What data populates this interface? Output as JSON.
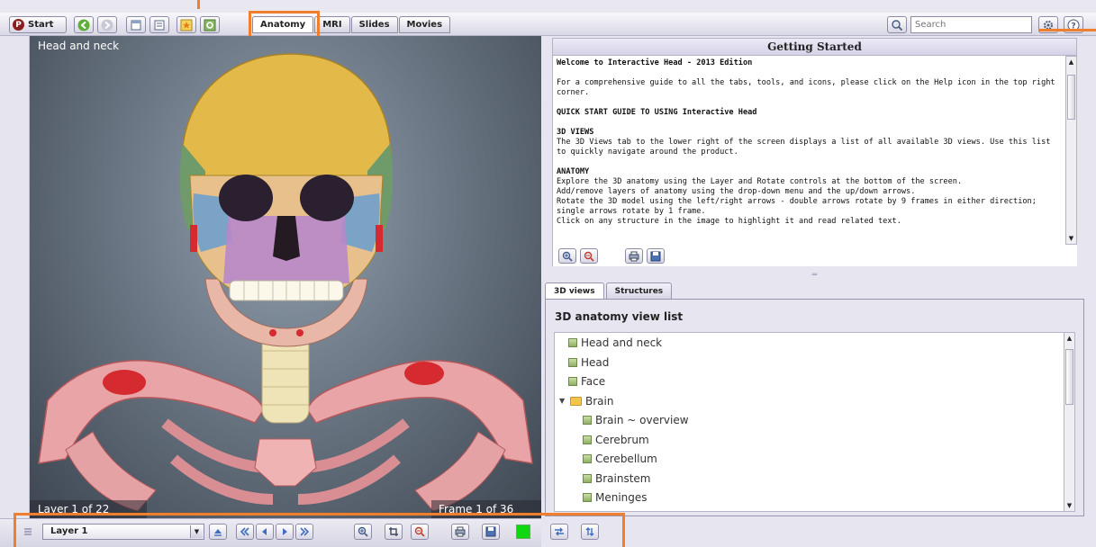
{
  "toolbar": {
    "start_label": "Start",
    "start_logo": "P",
    "icons": [
      "back-arrow-icon",
      "forward-arrow-icon",
      "page-icon",
      "notes-icon",
      "star-icon",
      "settings-gear-icon"
    ],
    "search_placeholder": "Search",
    "right_icons": [
      "settings-icon",
      "help-icon"
    ]
  },
  "tabs": [
    {
      "label": "Anatomy",
      "active": true
    },
    {
      "label": "MRI",
      "active": false
    },
    {
      "label": "Slides",
      "active": false
    },
    {
      "label": "Movies",
      "active": false
    }
  ],
  "viewer": {
    "view_title": "Head and neck",
    "layer_info": "Layer 1 of 22",
    "frame_info": "Frame 1 of 36"
  },
  "getting_started": {
    "title": "Getting Started",
    "lines": [
      {
        "text": "Welcome to Interactive Head - 2013 Edition",
        "bold": true
      },
      {
        "text": "",
        "bold": false
      },
      {
        "text": "For a comprehensive guide to all the tabs, tools, and icons, please click on the Help icon in the top right corner.",
        "bold": false
      },
      {
        "text": "",
        "bold": false
      },
      {
        "text": "QUICK START GUIDE TO USING Interactive Head",
        "bold": true
      },
      {
        "text": "",
        "bold": false
      },
      {
        "text": "3D VIEWS",
        "bold": true
      },
      {
        "text": "The 3D Views tab to the lower right of the screen displays a list of all available 3D views. Use this list to quickly navigate around the product.",
        "bold": false
      },
      {
        "text": "",
        "bold": false
      },
      {
        "text": "ANATOMY",
        "bold": true
      },
      {
        "text": "Explore the 3D anatomy using the Layer and Rotate controls at the bottom of the screen.",
        "bold": false
      },
      {
        "text": "Add/remove layers of anatomy using the drop-down menu and the up/down arrows.",
        "bold": false
      },
      {
        "text": "Rotate the 3D model using the left/right arrows - double arrows rotate by 9 frames in either direction; single arrows rotate by 1 frame.",
        "bold": false
      },
      {
        "text": "Click on any structure in the image to highlight it and read related text.",
        "bold": false
      }
    ],
    "tool_icons": [
      "zoom-in-icon",
      "zoom-out-icon",
      "print-icon",
      "save-icon"
    ]
  },
  "lower_tabs": [
    {
      "label": "3D views",
      "active": true
    },
    {
      "label": "Structures",
      "active": false
    }
  ],
  "views": {
    "title": "3D anatomy view list",
    "items": [
      {
        "label": "Head and neck",
        "level": 0,
        "type": "view"
      },
      {
        "label": "Head",
        "level": 0,
        "type": "view"
      },
      {
        "label": "Face",
        "level": 0,
        "type": "view"
      },
      {
        "label": "Brain",
        "level": 0,
        "type": "folder"
      },
      {
        "label": "Brain ~ overview",
        "level": 1,
        "type": "view"
      },
      {
        "label": "Cerebrum",
        "level": 1,
        "type": "view"
      },
      {
        "label": "Cerebellum",
        "level": 1,
        "type": "view"
      },
      {
        "label": "Brainstem",
        "level": 1,
        "type": "view"
      },
      {
        "label": "Meninges",
        "level": 1,
        "type": "view"
      }
    ]
  },
  "bottom": {
    "layer_value": "Layer 1",
    "color_swatch": "#10d810",
    "control_icons": [
      "layer-up-icon",
      "rotate-left-fast-icon",
      "rotate-left-icon",
      "rotate-right-icon",
      "rotate-right-fast-icon",
      "zoom-in-icon",
      "crop-icon",
      "zoom-out-icon",
      "print-icon",
      "save-icon",
      "swap-icon",
      "sort-icon"
    ]
  },
  "colors": {
    "highlight": "#ef7f2c",
    "accent_green": "#10d810"
  }
}
